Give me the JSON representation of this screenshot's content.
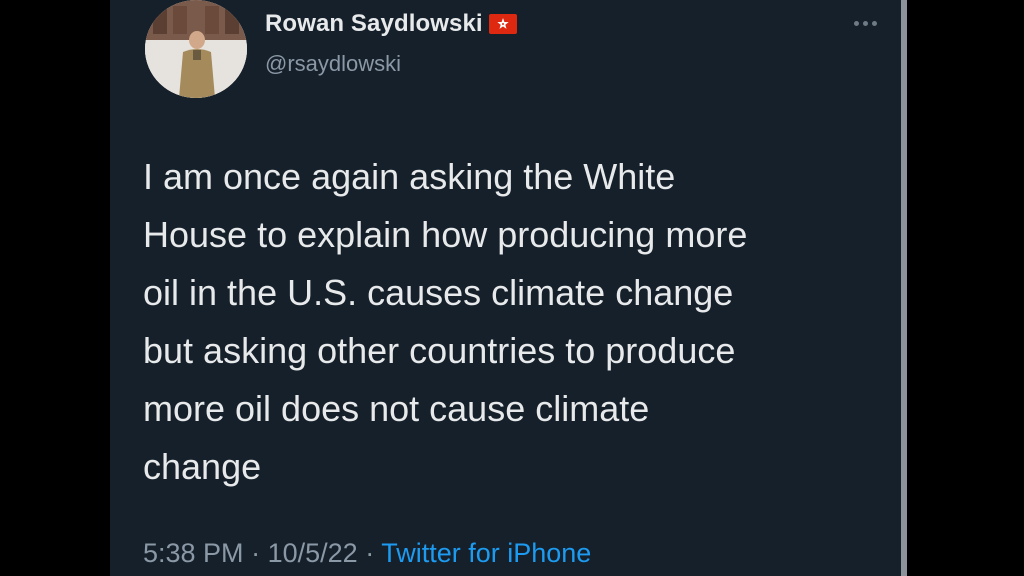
{
  "tweet": {
    "author": {
      "display_name": "Rowan Saydlowski",
      "handle": "@rsaydlowski",
      "flag_icon": "hong-kong-flag-icon"
    },
    "text": "I am once again asking the White\nHouse to explain how producing more\noil in the U.S. causes climate change\nbut asking other countries to produce\nmore oil does not cause climate\nchange",
    "time": "5:38 PM",
    "date": "10/5/22",
    "separator": "·",
    "source": "Twitter for iPhone",
    "more_icon": "more-options-icon"
  },
  "colors": {
    "background": "#15202b",
    "text_primary": "#e7e9ea",
    "text_secondary": "#8b98a5",
    "accent": "#1d9bf0"
  }
}
